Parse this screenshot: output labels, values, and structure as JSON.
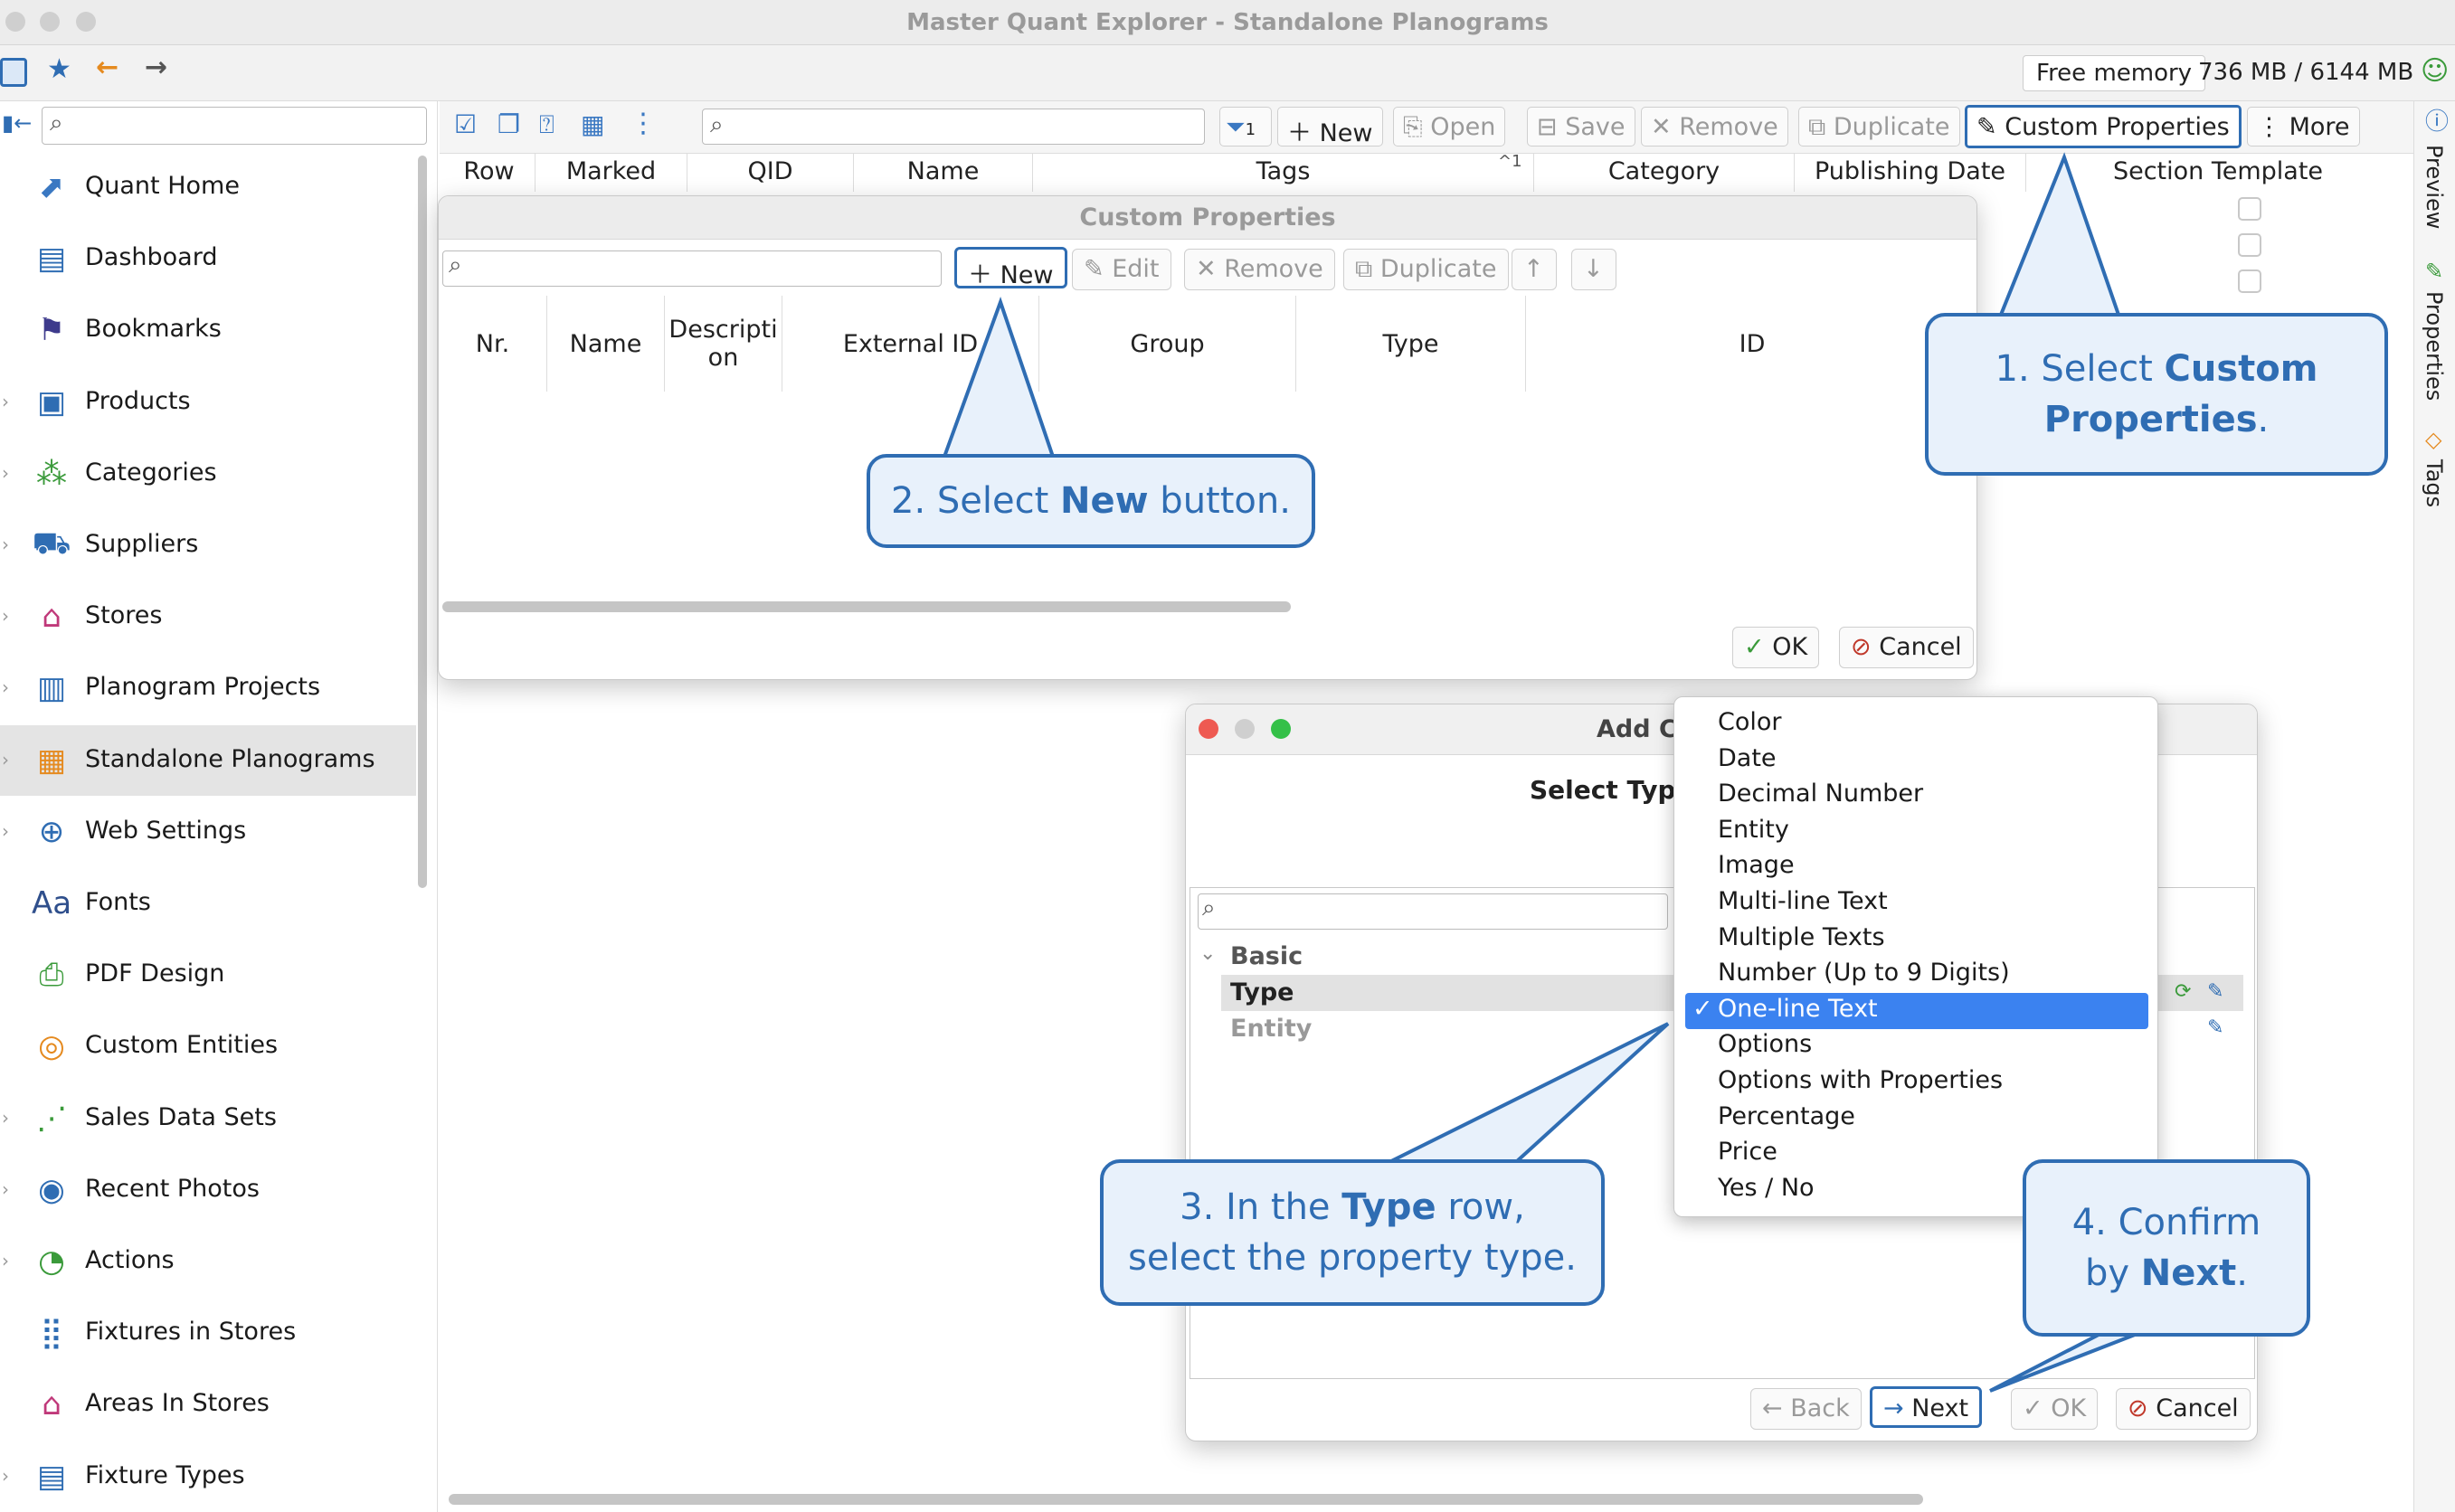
{
  "window": {
    "title": "Master Quant Explorer - Standalone Planograms"
  },
  "appbar": {
    "free_memory_label": "Free memory",
    "memory_value": "736 MB / 6144 MB"
  },
  "sidebar": {
    "items": [
      {
        "label": "Quant Home",
        "icon": "home-icon",
        "expandable": false
      },
      {
        "label": "Dashboard",
        "icon": "dashboard-icon",
        "expandable": false
      },
      {
        "label": "Bookmarks",
        "icon": "bookmark-icon",
        "expandable": false
      },
      {
        "label": "Products",
        "icon": "products-icon",
        "expandable": true
      },
      {
        "label": "Categories",
        "icon": "categories-icon",
        "expandable": true
      },
      {
        "label": "Suppliers",
        "icon": "suppliers-icon",
        "expandable": true
      },
      {
        "label": "Stores",
        "icon": "stores-icon",
        "expandable": true
      },
      {
        "label": "Planogram Projects",
        "icon": "planogram-projects-icon",
        "expandable": true
      },
      {
        "label": "Standalone Planograms",
        "icon": "standalone-planograms-icon",
        "expandable": true
      },
      {
        "label": "Web Settings",
        "icon": "web-settings-icon",
        "expandable": true
      },
      {
        "label": "Fonts",
        "icon": "fonts-icon",
        "expandable": false
      },
      {
        "label": "PDF Design",
        "icon": "pdf-design-icon",
        "expandable": false
      },
      {
        "label": "Custom Entities",
        "icon": "custom-entities-icon",
        "expandable": false
      },
      {
        "label": "Sales Data Sets",
        "icon": "sales-data-icon",
        "expandable": true
      },
      {
        "label": "Recent Photos",
        "icon": "photos-icon",
        "expandable": true
      },
      {
        "label": "Actions",
        "icon": "actions-icon",
        "expandable": true
      },
      {
        "label": "Fixtures in Stores",
        "icon": "fixtures-icon",
        "expandable": false
      },
      {
        "label": "Areas In Stores",
        "icon": "areas-icon",
        "expandable": false
      },
      {
        "label": "Fixture Types",
        "icon": "fixture-types-icon",
        "expandable": true
      }
    ]
  },
  "toolbar": {
    "new_label": "New",
    "open_label": "Open",
    "save_label": "Save",
    "remove_label": "Remove",
    "duplicate_label": "Duplicate",
    "custom_properties_label": "Custom Properties",
    "more_label": "More",
    "filter_count": "1"
  },
  "grid": {
    "columns": [
      "Row",
      "Marked",
      "QID",
      "Name",
      "Tags",
      "Category",
      "Publishing Date",
      "Section Template"
    ],
    "sort_indicator": "1"
  },
  "right_tabs": [
    "Preview",
    "Properties",
    "Tags"
  ],
  "custom_properties_dialog": {
    "title": "Custom Properties",
    "new_label": "New",
    "edit_label": "Edit",
    "remove_label": "Remove",
    "duplicate_label": "Duplicate",
    "columns": [
      "Nr.",
      "Name",
      "Descripti on",
      "External ID",
      "Group",
      "Type",
      "ID"
    ],
    "ok_label": "OK",
    "cancel_label": "Cancel"
  },
  "add_dialog": {
    "title": "Add Cu",
    "heading": "Select Type",
    "tree": {
      "basic": "Basic",
      "type": "Type",
      "entity": "Entity"
    },
    "back_label": "Back",
    "next_label": "Next",
    "ok_label": "OK",
    "cancel_label": "Cancel"
  },
  "type_dropdown": {
    "options": [
      "Color",
      "Date",
      "Decimal Number",
      "Entity",
      "Image",
      "Multi-line Text",
      "Multiple Texts",
      "Number (Up to 9 Digits)",
      "One-line Text",
      "Options",
      "Options with Properties",
      "Percentage",
      "Price",
      "Yes / No"
    ],
    "selected": "One-line Text"
  },
  "callouts": {
    "c1_pre": "1. Select ",
    "c1_bold": "Custom Properties",
    "c1_post": ".",
    "c2_pre": "2. Select ",
    "c2_bold": "New",
    "c2_post": " button.",
    "c3_pre": "3. In the ",
    "c3_bold": "Type",
    "c3_post": " row,",
    "c3_line2": "select the  property type.",
    "c4_pre": "4. Confirm",
    "c4_line2_pre": "by ",
    "c4_bold": "Next",
    "c4_post": "."
  },
  "colors": {
    "accent": "#2f6db3",
    "callout_bg": "#e8f1fb",
    "selection": "#3b82f0"
  }
}
